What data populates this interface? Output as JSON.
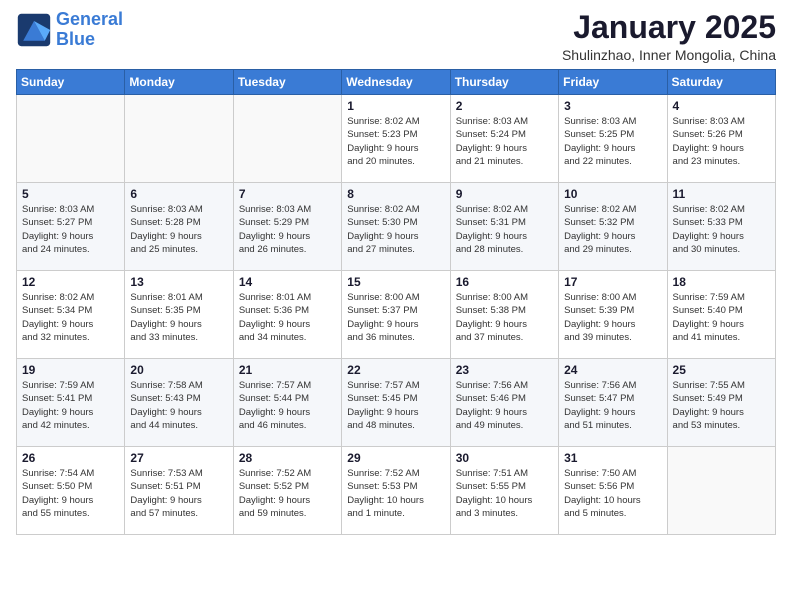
{
  "header": {
    "logo_line1": "General",
    "logo_line2": "Blue",
    "month": "January 2025",
    "location": "Shulinzhao, Inner Mongolia, China"
  },
  "weekdays": [
    "Sunday",
    "Monday",
    "Tuesday",
    "Wednesday",
    "Thursday",
    "Friday",
    "Saturday"
  ],
  "weeks": [
    [
      {
        "day": "",
        "info": ""
      },
      {
        "day": "",
        "info": ""
      },
      {
        "day": "",
        "info": ""
      },
      {
        "day": "1",
        "info": "Sunrise: 8:02 AM\nSunset: 5:23 PM\nDaylight: 9 hours\nand 20 minutes."
      },
      {
        "day": "2",
        "info": "Sunrise: 8:03 AM\nSunset: 5:24 PM\nDaylight: 9 hours\nand 21 minutes."
      },
      {
        "day": "3",
        "info": "Sunrise: 8:03 AM\nSunset: 5:25 PM\nDaylight: 9 hours\nand 22 minutes."
      },
      {
        "day": "4",
        "info": "Sunrise: 8:03 AM\nSunset: 5:26 PM\nDaylight: 9 hours\nand 23 minutes."
      }
    ],
    [
      {
        "day": "5",
        "info": "Sunrise: 8:03 AM\nSunset: 5:27 PM\nDaylight: 9 hours\nand 24 minutes."
      },
      {
        "day": "6",
        "info": "Sunrise: 8:03 AM\nSunset: 5:28 PM\nDaylight: 9 hours\nand 25 minutes."
      },
      {
        "day": "7",
        "info": "Sunrise: 8:03 AM\nSunset: 5:29 PM\nDaylight: 9 hours\nand 26 minutes."
      },
      {
        "day": "8",
        "info": "Sunrise: 8:02 AM\nSunset: 5:30 PM\nDaylight: 9 hours\nand 27 minutes."
      },
      {
        "day": "9",
        "info": "Sunrise: 8:02 AM\nSunset: 5:31 PM\nDaylight: 9 hours\nand 28 minutes."
      },
      {
        "day": "10",
        "info": "Sunrise: 8:02 AM\nSunset: 5:32 PM\nDaylight: 9 hours\nand 29 minutes."
      },
      {
        "day": "11",
        "info": "Sunrise: 8:02 AM\nSunset: 5:33 PM\nDaylight: 9 hours\nand 30 minutes."
      }
    ],
    [
      {
        "day": "12",
        "info": "Sunrise: 8:02 AM\nSunset: 5:34 PM\nDaylight: 9 hours\nand 32 minutes."
      },
      {
        "day": "13",
        "info": "Sunrise: 8:01 AM\nSunset: 5:35 PM\nDaylight: 9 hours\nand 33 minutes."
      },
      {
        "day": "14",
        "info": "Sunrise: 8:01 AM\nSunset: 5:36 PM\nDaylight: 9 hours\nand 34 minutes."
      },
      {
        "day": "15",
        "info": "Sunrise: 8:00 AM\nSunset: 5:37 PM\nDaylight: 9 hours\nand 36 minutes."
      },
      {
        "day": "16",
        "info": "Sunrise: 8:00 AM\nSunset: 5:38 PM\nDaylight: 9 hours\nand 37 minutes."
      },
      {
        "day": "17",
        "info": "Sunrise: 8:00 AM\nSunset: 5:39 PM\nDaylight: 9 hours\nand 39 minutes."
      },
      {
        "day": "18",
        "info": "Sunrise: 7:59 AM\nSunset: 5:40 PM\nDaylight: 9 hours\nand 41 minutes."
      }
    ],
    [
      {
        "day": "19",
        "info": "Sunrise: 7:59 AM\nSunset: 5:41 PM\nDaylight: 9 hours\nand 42 minutes."
      },
      {
        "day": "20",
        "info": "Sunrise: 7:58 AM\nSunset: 5:43 PM\nDaylight: 9 hours\nand 44 minutes."
      },
      {
        "day": "21",
        "info": "Sunrise: 7:57 AM\nSunset: 5:44 PM\nDaylight: 9 hours\nand 46 minutes."
      },
      {
        "day": "22",
        "info": "Sunrise: 7:57 AM\nSunset: 5:45 PM\nDaylight: 9 hours\nand 48 minutes."
      },
      {
        "day": "23",
        "info": "Sunrise: 7:56 AM\nSunset: 5:46 PM\nDaylight: 9 hours\nand 49 minutes."
      },
      {
        "day": "24",
        "info": "Sunrise: 7:56 AM\nSunset: 5:47 PM\nDaylight: 9 hours\nand 51 minutes."
      },
      {
        "day": "25",
        "info": "Sunrise: 7:55 AM\nSunset: 5:49 PM\nDaylight: 9 hours\nand 53 minutes."
      }
    ],
    [
      {
        "day": "26",
        "info": "Sunrise: 7:54 AM\nSunset: 5:50 PM\nDaylight: 9 hours\nand 55 minutes."
      },
      {
        "day": "27",
        "info": "Sunrise: 7:53 AM\nSunset: 5:51 PM\nDaylight: 9 hours\nand 57 minutes."
      },
      {
        "day": "28",
        "info": "Sunrise: 7:52 AM\nSunset: 5:52 PM\nDaylight: 9 hours\nand 59 minutes."
      },
      {
        "day": "29",
        "info": "Sunrise: 7:52 AM\nSunset: 5:53 PM\nDaylight: 10 hours\nand 1 minute."
      },
      {
        "day": "30",
        "info": "Sunrise: 7:51 AM\nSunset: 5:55 PM\nDaylight: 10 hours\nand 3 minutes."
      },
      {
        "day": "31",
        "info": "Sunrise: 7:50 AM\nSunset: 5:56 PM\nDaylight: 10 hours\nand 5 minutes."
      },
      {
        "day": "",
        "info": ""
      }
    ]
  ]
}
